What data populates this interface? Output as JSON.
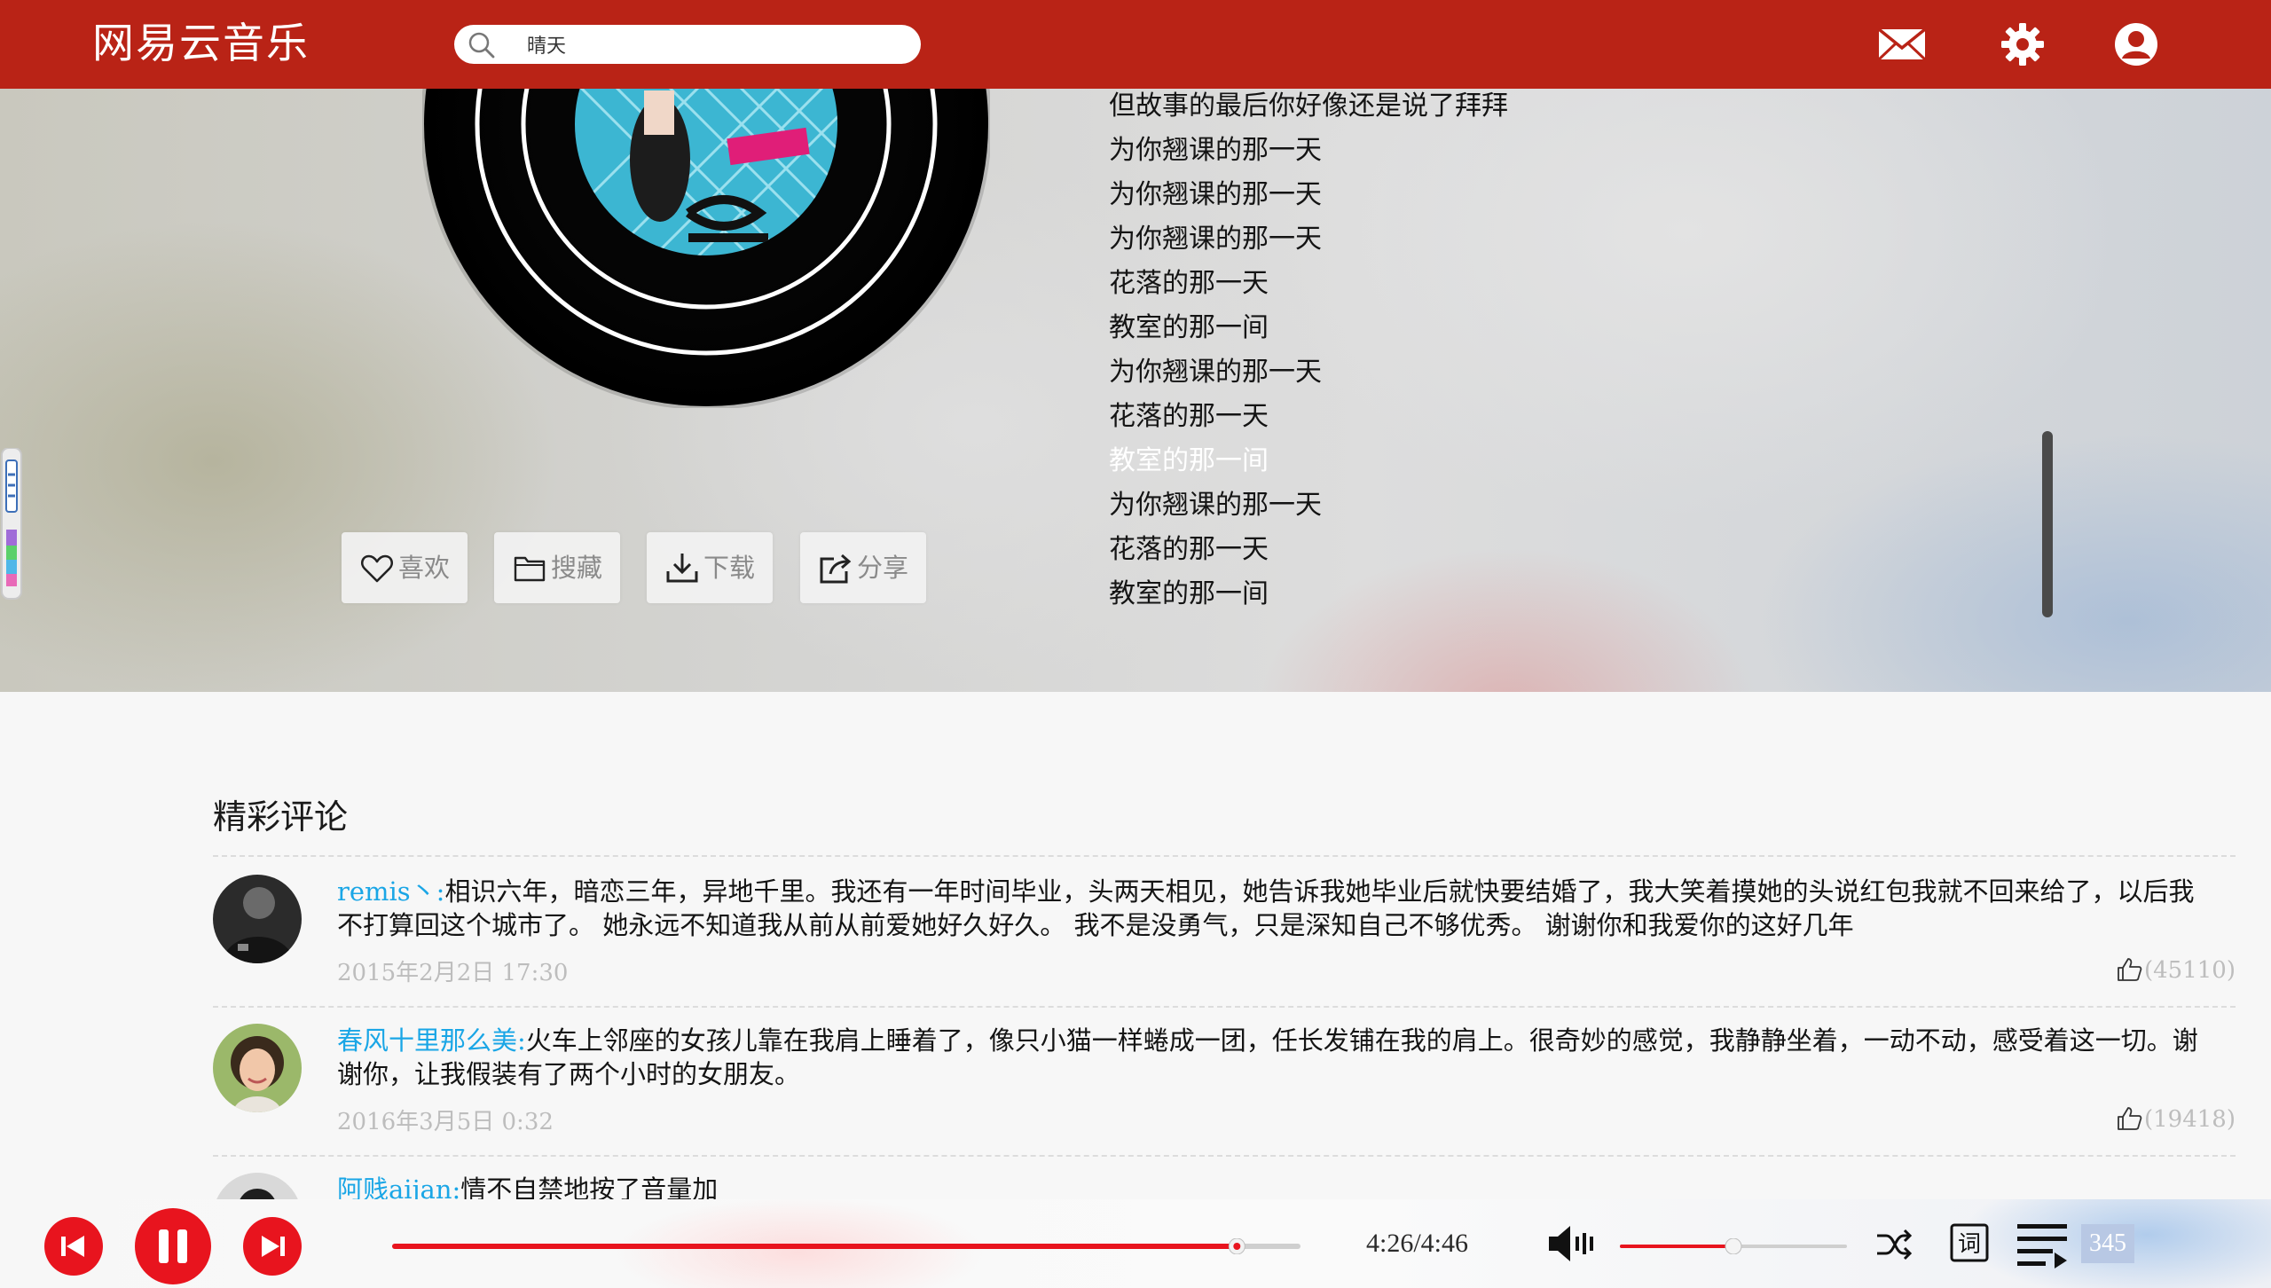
{
  "app": {
    "title": "网易云音乐",
    "brand_color": "#b92316"
  },
  "search": {
    "value": "晴天",
    "icon": "search-icon"
  },
  "header_icons": [
    "mail-icon",
    "gear-icon",
    "user-icon"
  ],
  "song_actions": [
    {
      "label": "喜欢",
      "icon": "heart-icon"
    },
    {
      "label": "搜藏",
      "icon": "folder-icon"
    },
    {
      "label": "下载",
      "icon": "download-icon"
    },
    {
      "label": "分享",
      "icon": "share-icon"
    }
  ],
  "lyrics": {
    "lines": [
      "但故事的最后你好像还是说了拜拜",
      "为你翘课的那一天",
      "为你翘课的那一天",
      "为你翘课的那一天",
      "花落的那一天",
      "教室的那一间",
      "为你翘课的那一天",
      "花落的那一天",
      "教室的那一间",
      "为你翘课的那一天",
      "花落的那一天",
      "教室的那一间"
    ],
    "active_index": 8
  },
  "comments": {
    "title": "精彩评论",
    "items": [
      {
        "user": "remis丶:",
        "text": "相识六年，暗恋三年，异地千里。我还有一年时间毕业，头两天相见，她告诉我她毕业后就快要结婚了，我大笑着摸她的头说红包我就不回来给了，以后我不打算回这个城市了。 她永远不知道我从前从前爱她好久好久。 我不是没勇气，只是深知自己不够优秀。 谢谢你和我爱你的这好几年",
        "time": "2015年2月2日 17:30",
        "likes": "(45110)"
      },
      {
        "user": "春风十里那么美:",
        "text": "火车上邻座的女孩儿靠在我肩上睡着了，像只小猫一样蜷成一团，任长发铺在我的肩上。很奇妙的感觉，我静静坐着，一动不动，感受着这一切。谢谢你，让我假装有了两个小时的女朋友。",
        "time": "2016年3月5日 0:32",
        "likes": "(19418)"
      },
      {
        "user": "阿贱aijan:",
        "text": "情不自禁地按了音量加"
      }
    ]
  },
  "player": {
    "time": "4:26/4:46",
    "progress": 0.93,
    "volume": 0.5,
    "playlist_count": "345",
    "lyrics_toggle": "词",
    "accent_color": "#e8141e"
  }
}
